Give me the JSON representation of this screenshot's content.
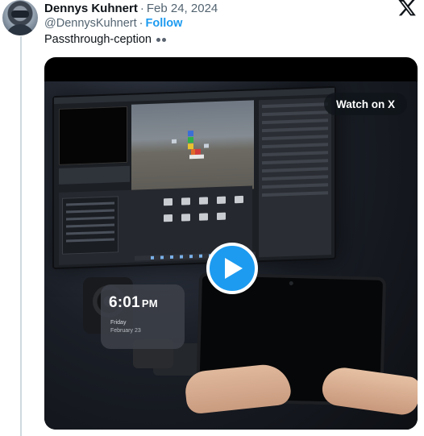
{
  "author": {
    "name": "Dennys Kuhnert",
    "handle": "@DennysKuhnert",
    "follow_label": "Follow",
    "separator": "·",
    "date": "Feb 24, 2024"
  },
  "tweet": {
    "text": "Passthrough-ception"
  },
  "media": {
    "watch_label": "Watch on X",
    "clock_time": "6:01",
    "clock_ampm": "PM",
    "clock_day": "Friday",
    "clock_date": "February 23"
  },
  "colors": {
    "accent": "#1d9bf0",
    "text": "#0f1419",
    "secondary": "#536471"
  },
  "icons": {
    "logo": "x-logo-icon",
    "play": "play-icon",
    "emoji": "eyes-emoji-icon"
  }
}
